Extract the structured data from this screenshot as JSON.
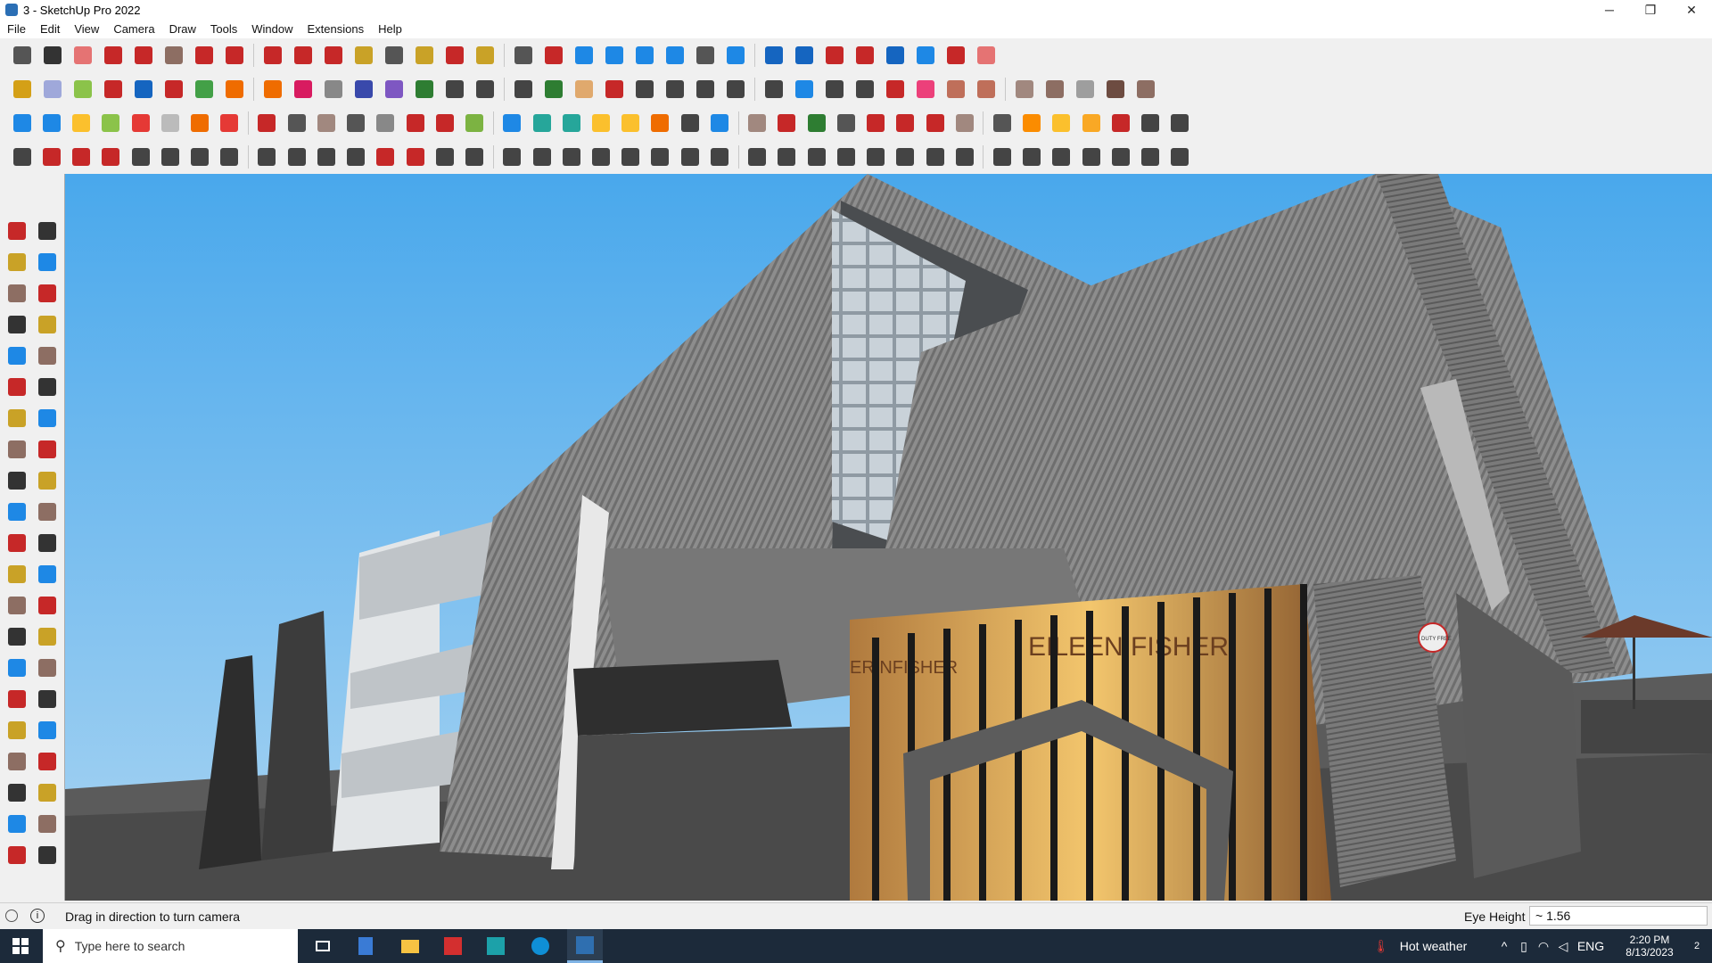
{
  "window": {
    "title": "3 - SketchUp Pro 2022",
    "minimize": "─",
    "maximize": "❐",
    "close": "✕"
  },
  "menu": [
    "File",
    "Edit",
    "View",
    "Camera",
    "Draw",
    "Tools",
    "Window",
    "Extensions",
    "Help"
  ],
  "toolbars": {
    "row1": [
      {
        "name": "zoom-icon",
        "color": "#555"
      },
      {
        "name": "select-icon",
        "color": "#333"
      },
      {
        "name": "eraser-icon",
        "color": "#e57373"
      },
      {
        "name": "pencil-icon",
        "color": "#c62828"
      },
      {
        "name": "arc-icon",
        "color": "#c62828"
      },
      {
        "name": "rectangle-icon",
        "color": "#8d6e63"
      },
      {
        "name": "push-pull-icon",
        "color": "#c62828"
      },
      {
        "name": "follow-me-icon",
        "color": "#c62828"
      },
      {
        "name": "move-icon",
        "color": "#c62828"
      },
      {
        "name": "rotate-icon",
        "color": "#c62828"
      },
      {
        "name": "scale-icon",
        "color": "#c62828"
      },
      {
        "name": "tape-measure-icon",
        "color": "#c9a227"
      },
      {
        "name": "text-icon",
        "color": "#555"
      },
      {
        "name": "paint-bucket-icon",
        "color": "#c9a227"
      },
      {
        "name": "orbit-icon",
        "color": "#c62828"
      },
      {
        "name": "pan-icon",
        "color": "#c9a227"
      },
      {
        "name": "zoom-window-icon",
        "color": "#555"
      },
      {
        "name": "zoom-extents-icon",
        "color": "#c62828"
      },
      {
        "name": "warehouse-icon",
        "color": "#1e88e5"
      },
      {
        "name": "extension-warehouse-icon",
        "color": "#1e88e5"
      },
      {
        "name": "layout-icon",
        "color": "#1e88e5"
      },
      {
        "name": "share-model-icon",
        "color": "#1e88e5"
      },
      {
        "name": "account-icon",
        "color": "#555"
      },
      {
        "name": "sandbox-icon",
        "color": "#1e88e5"
      },
      {
        "name": "component-icon",
        "color": "#1565c0"
      },
      {
        "name": "solid-tools-icon",
        "color": "#1565c0"
      },
      {
        "name": "intersect-icon",
        "color": "#c62828"
      },
      {
        "name": "trim-icon",
        "color": "#c62828"
      },
      {
        "name": "section-icon",
        "color": "#1565c0"
      },
      {
        "name": "undo-icon",
        "color": "#1e88e5"
      },
      {
        "name": "redo-icon",
        "color": "#c62828"
      },
      {
        "name": "preferences-icon",
        "color": "#e57373"
      }
    ],
    "row2": [
      {
        "name": "iso-view-icon",
        "color": "#d4a017"
      },
      {
        "name": "top-view-icon",
        "color": "#9fa8da"
      },
      {
        "name": "front-view-icon",
        "color": "#8bc34a"
      },
      {
        "name": "extrude-icon",
        "color": "#c62828"
      },
      {
        "name": "shell-icon",
        "color": "#1565c0"
      },
      {
        "name": "red-r-icon",
        "color": "#c62828"
      },
      {
        "name": "green-v-icon",
        "color": "#43a047"
      },
      {
        "name": "orange-n-icon",
        "color": "#ef6c00"
      },
      {
        "name": "orange-x-icon",
        "color": "#ef6c00"
      },
      {
        "name": "magenta-f-icon",
        "color": "#d81b60"
      },
      {
        "name": "curve-icon",
        "color": "#888"
      },
      {
        "name": "blue-slash-icon",
        "color": "#3949ab"
      },
      {
        "name": "purple-slash-icon",
        "color": "#7e57c2"
      },
      {
        "name": "green-box-icon",
        "color": "#2e7d32"
      },
      {
        "name": "house-icon",
        "color": "#444"
      },
      {
        "name": "house-roof-icon",
        "color": "#444"
      },
      {
        "name": "house-outline-icon",
        "color": "#444"
      },
      {
        "name": "font-icon",
        "color": "#2e7d32"
      },
      {
        "name": "hand-icon",
        "color": "#e0a96d"
      },
      {
        "name": "ruler-icon",
        "color": "#c62828"
      },
      {
        "name": "shape-rect-icon",
        "color": "#444"
      },
      {
        "name": "shape-circle-icon",
        "color": "#444"
      },
      {
        "name": "shape-hex-icon",
        "color": "#444"
      },
      {
        "name": "shape-ellipse-icon",
        "color": "#444"
      },
      {
        "name": "shape-para-icon",
        "color": "#444"
      },
      {
        "name": "shape-arc-icon",
        "color": "#1e88e5"
      },
      {
        "name": "shape-spiral-icon",
        "color": "#444"
      },
      {
        "name": "shape-lasso-icon",
        "color": "#444"
      },
      {
        "name": "magic-icon",
        "color": "#c62828"
      },
      {
        "name": "erase-pink-icon",
        "color": "#ec407a"
      },
      {
        "name": "bag-icon",
        "color": "#bf6f5a"
      },
      {
        "name": "grid-icon",
        "color": "#bf6f5a"
      },
      {
        "name": "terrain-icon",
        "color": "#a1887f"
      },
      {
        "name": "rock-icon",
        "color": "#8d6e63"
      },
      {
        "name": "glove-icon",
        "color": "#9e9e9e"
      },
      {
        "name": "wood-icon",
        "color": "#6d4c41"
      },
      {
        "name": "brown-shape-icon",
        "color": "#8d6e63"
      }
    ],
    "row3": [
      {
        "name": "blue-tile-icon",
        "color": "#1e88e5"
      },
      {
        "name": "blue-diamond-icon",
        "color": "#1e88e5"
      },
      {
        "name": "yellow-tile-icon",
        "color": "#fbc02d"
      },
      {
        "name": "green-tile-icon",
        "color": "#8bc34a"
      },
      {
        "name": "red-tile-icon",
        "color": "#e53935"
      },
      {
        "name": "outline-tile-icon",
        "color": "#bbb"
      },
      {
        "name": "orange-loop-icon",
        "color": "#ef6c00"
      },
      {
        "name": "red-square-icon",
        "color": "#e53935"
      },
      {
        "name": "stack-icon",
        "color": "#c62828"
      },
      {
        "name": "flag-icon",
        "color": "#555"
      },
      {
        "name": "box-brown-icon",
        "color": "#a1887f"
      },
      {
        "name": "chain-icon",
        "color": "#555"
      },
      {
        "name": "hook-icon",
        "color": "#888"
      },
      {
        "name": "nodes-icon",
        "color": "#c62828"
      },
      {
        "name": "plus-red-icon",
        "color": "#c62828"
      },
      {
        "name": "plus-green-icon",
        "color": "#7cb342"
      },
      {
        "name": "x-blue-icon",
        "color": "#1e88e5"
      },
      {
        "name": "cone-icon",
        "color": "#26a69a"
      },
      {
        "name": "drip-icon",
        "color": "#26a69a"
      },
      {
        "name": "warning-icon",
        "color": "#fbc02d"
      },
      {
        "name": "swirl-icon",
        "color": "#fbc02d"
      },
      {
        "name": "swirl-orange-icon",
        "color": "#ef6c00"
      },
      {
        "name": "gear-loop-icon",
        "color": "#444"
      },
      {
        "name": "move-cross-icon",
        "color": "#1e88e5"
      },
      {
        "name": "bucket-icon",
        "color": "#a1887f"
      },
      {
        "name": "magnet-icon",
        "color": "#c62828"
      },
      {
        "name": "green-s-icon",
        "color": "#2e7d32"
      },
      {
        "name": "stair-icon",
        "color": "#555"
      },
      {
        "name": "cube-red-icon",
        "color": "#c62828"
      },
      {
        "name": "boxes-icon",
        "color": "#c62828"
      },
      {
        "name": "box-red-icon",
        "color": "#c62828"
      },
      {
        "name": "pattern-icon",
        "color": "#a1887f"
      },
      {
        "name": "frame-icon",
        "color": "#555"
      },
      {
        "name": "orange-grid-icon",
        "color": "#fb8c00"
      },
      {
        "name": "grid-yellow-icon",
        "color": "#fbc02d"
      },
      {
        "name": "grid-gold-icon",
        "color": "#f9a825"
      },
      {
        "name": "explode-icon",
        "color": "#c62828"
      },
      {
        "name": "dots-circle-icon",
        "color": "#444"
      },
      {
        "name": "qr-icon",
        "color": "#444"
      }
    ],
    "row4": [
      {
        "name": "vertex-icon",
        "color": "#444"
      },
      {
        "name": "spline-icon",
        "color": "#c62828"
      },
      {
        "name": "red-car-icon",
        "color": "#c62828"
      },
      {
        "name": "scissors-icon",
        "color": "#c62828"
      },
      {
        "name": "gear-outline-icon",
        "color": "#444"
      },
      {
        "name": "layers-outline-icon",
        "color": "#444"
      },
      {
        "name": "pipe-icon",
        "color": "#444"
      },
      {
        "name": "torus-icon",
        "color": "#444"
      },
      {
        "name": "sphere-icon",
        "color": "#444"
      },
      {
        "name": "funnel-icon",
        "color": "#444"
      },
      {
        "name": "line-icon",
        "color": "#444"
      },
      {
        "name": "angle-icon",
        "color": "#444"
      },
      {
        "name": "slope-icon",
        "color": "#c62828"
      },
      {
        "name": "curve-red-icon",
        "color": "#c62828"
      },
      {
        "name": "cylinder-icon",
        "color": "#444"
      },
      {
        "name": "cone-outline-icon",
        "color": "#444"
      },
      {
        "name": "fence-icon",
        "color": "#444"
      },
      {
        "name": "roll-icon",
        "color": "#444"
      },
      {
        "name": "hand-outline-icon",
        "color": "#444"
      },
      {
        "name": "leaf-icon",
        "color": "#444"
      },
      {
        "name": "star-icon",
        "color": "#444"
      },
      {
        "name": "fan-icon",
        "color": "#444"
      },
      {
        "name": "blade-icon",
        "color": "#444"
      },
      {
        "name": "fork-icon",
        "color": "#444"
      },
      {
        "name": "fork2-icon",
        "color": "#444"
      },
      {
        "name": "fork3-icon",
        "color": "#444"
      },
      {
        "name": "bench-icon",
        "color": "#444"
      },
      {
        "name": "hatch-icon",
        "color": "#444"
      },
      {
        "name": "dome-icon",
        "color": "#444"
      },
      {
        "name": "pillar-icon",
        "color": "#444"
      },
      {
        "name": "columns-icon",
        "color": "#444"
      },
      {
        "name": "crosshatch-icon",
        "color": "#444"
      },
      {
        "name": "lines-icon",
        "color": "#444"
      },
      {
        "name": "bars-icon",
        "color": "#444"
      },
      {
        "name": "gear-fill-icon",
        "color": "#444"
      },
      {
        "name": "gear-half-icon",
        "color": "#444"
      },
      {
        "name": "stripes-icon",
        "color": "#444"
      },
      {
        "name": "fringe-icon",
        "color": "#444"
      },
      {
        "name": "flower-icon",
        "color": "#444"
      }
    ]
  },
  "left_toolbar": [
    "select-icon",
    "orbit-icon",
    "paint-bucket-icon",
    "eraser-icon",
    "component-icon",
    "tape-measure-icon",
    "line-icon",
    "freehand-icon",
    "rectangle-icon",
    "rotated-rect-icon",
    "circle-icon",
    "polygon-icon",
    "arc-icon",
    "pie-icon",
    "two-point-arc-icon",
    "three-point-arc-icon",
    "move-icon",
    "push-pull-icon",
    "rotate-icon",
    "follow-me-icon",
    "scale-icon",
    "offset-icon",
    "tape-icon",
    "dimension-icon",
    "protractor-icon",
    "text-icon",
    "axes-icon",
    "3d-text-icon",
    "orbit2-icon",
    "pan-icon",
    "zoom-icon",
    "zoom-window-icon",
    "zoom-extents-icon",
    "previous-view-icon",
    "position-camera-icon",
    "look-around-icon",
    "walk-icon",
    "section-plane-icon",
    "warehouse-icon",
    "sandbox-icon",
    "layers-icon",
    "share-icon"
  ],
  "status": {
    "hint": "Drag in direction to turn camera",
    "measure_label": "Eye Height",
    "measure_value": "~ 1.56"
  },
  "scene": {
    "store_sign": "EILEEN FISHER",
    "store_sign_reflection": "ER  NFISHER",
    "round_sign": "DUTY FREE"
  },
  "taskbar": {
    "search_placeholder": "Type here to search",
    "weather": "Hot weather",
    "language": "ENG",
    "time": "2:20 PM",
    "date": "8/13/2023",
    "notifications": "2"
  }
}
